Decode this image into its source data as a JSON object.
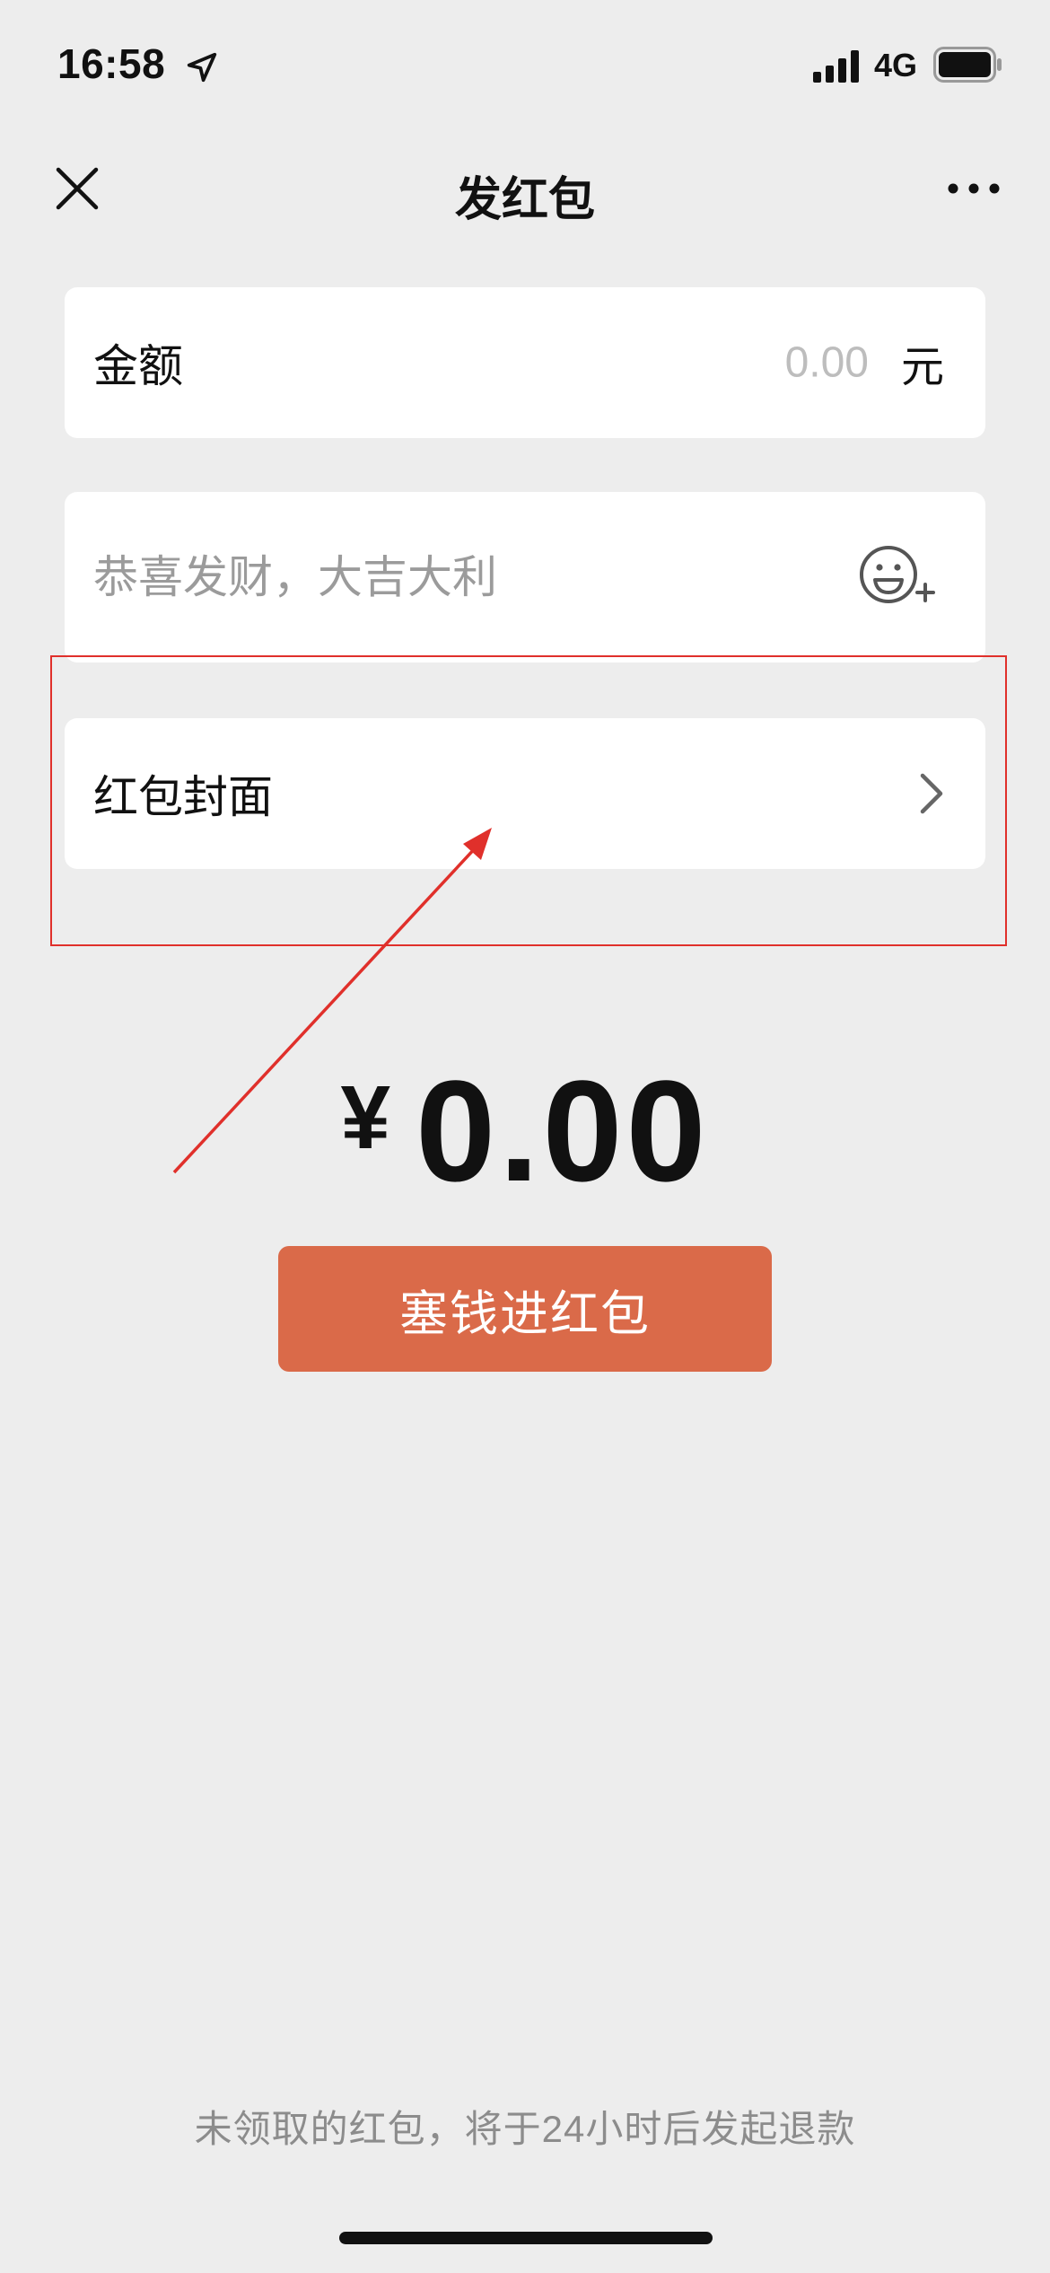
{
  "status_bar": {
    "time": "16:58",
    "network": "4G"
  },
  "nav": {
    "title": "发红包"
  },
  "amount_row": {
    "label": "金额",
    "placeholder": "0.00",
    "unit": "元"
  },
  "greeting_row": {
    "placeholder": "恭喜发财，大吉大利"
  },
  "cover_row": {
    "label": "红包封面"
  },
  "total": {
    "currency": "¥",
    "value": "0.00"
  },
  "submit_button": {
    "label": "塞钱进红包"
  },
  "footer": {
    "note": "未领取的红包，将于24小时后发起退款"
  },
  "colors": {
    "background": "#ededed",
    "button": "#da6a49",
    "annotation": "#e0302b"
  },
  "icons": [
    "location-arrow-icon",
    "signal-icon",
    "battery-icon",
    "close-icon",
    "more-icon",
    "emoji-add-icon",
    "chevron-right-icon"
  ]
}
